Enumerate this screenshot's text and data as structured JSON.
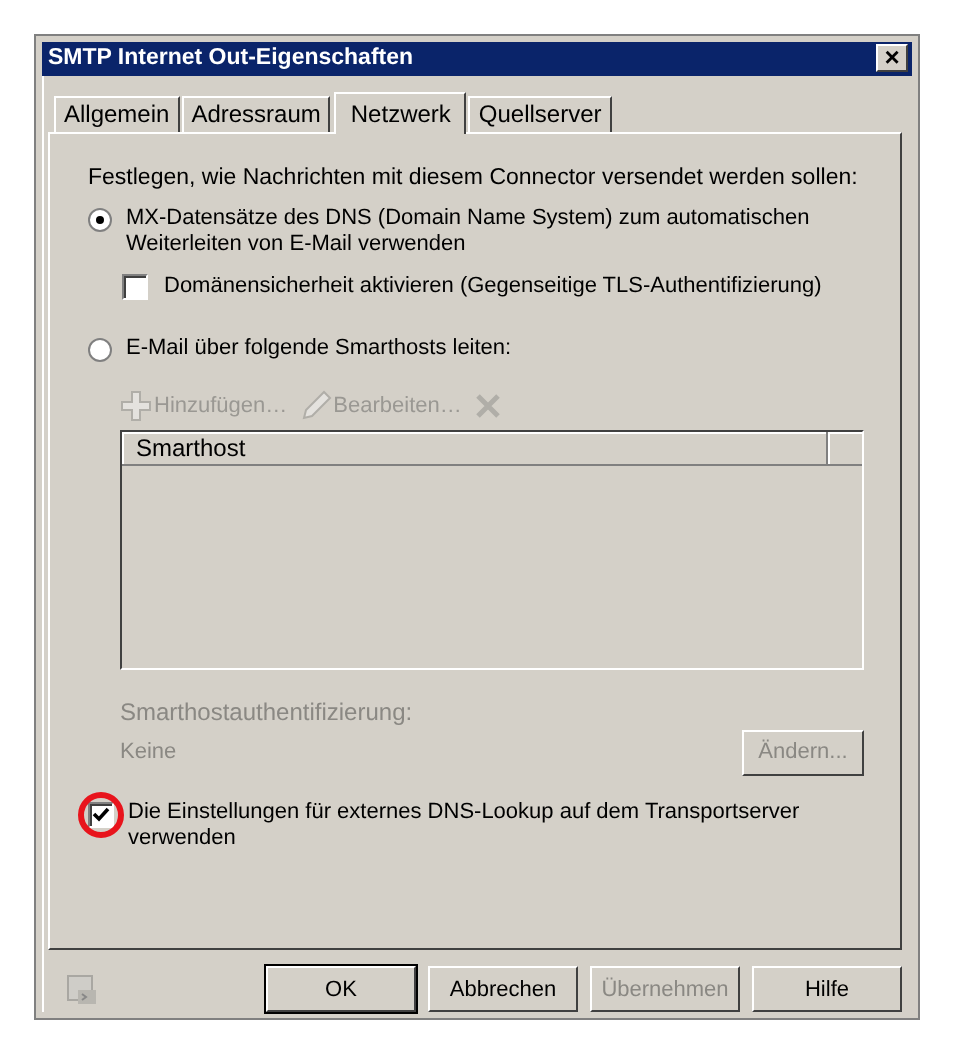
{
  "window": {
    "title": "SMTP Internet Out-Eigenschaften",
    "close": "×"
  },
  "tabs": [
    {
      "label": "Allgemein",
      "selected": false
    },
    {
      "label": "Adressraum",
      "selected": false
    },
    {
      "label": "Netzwerk",
      "selected": true
    },
    {
      "label": "Quellserver",
      "selected": false
    }
  ],
  "intro": "Festlegen, wie Nachrichten mit diesem Connector versendet werden sollen:",
  "routing": [
    {
      "label": "MX-Datensätze des DNS (Domain Name System) zum automatischen Weiterleiten von E-Mail verwenden",
      "selected": true
    },
    {
      "label": "E-Mail über folgende Smarthosts leiten:",
      "selected": false
    }
  ],
  "domain_security": {
    "label": "Domänensicherheit aktivieren (Gegenseitige TLS-Authentifizierung)",
    "checked": false
  },
  "toolbar": [
    {
      "kind": "add",
      "label": "Hinzufügen…",
      "disabled": true
    },
    {
      "kind": "edit",
      "label": "Bearbeiten…",
      "disabled": true
    },
    {
      "kind": "remove",
      "disabled": true
    }
  ],
  "table": {
    "columns": [
      "Smarthost"
    ]
  },
  "auth": {
    "label": "Smarthostauthentifizierung:",
    "value": "Keine",
    "button": "Ändern...",
    "disabled": true
  },
  "external_dns": {
    "label": "Die Einstellungen für externes DNS-Lookup auf dem Transportserver verwenden",
    "checked": true,
    "highlighted": true
  },
  "buttons": [
    {
      "label": "OK",
      "default": true,
      "disabled": false
    },
    {
      "label": "Abbrechen",
      "default": false,
      "disabled": false
    },
    {
      "label": "Übernehmen",
      "default": false,
      "disabled": true
    },
    {
      "label": "Hilfe",
      "default": false,
      "disabled": false
    }
  ]
}
